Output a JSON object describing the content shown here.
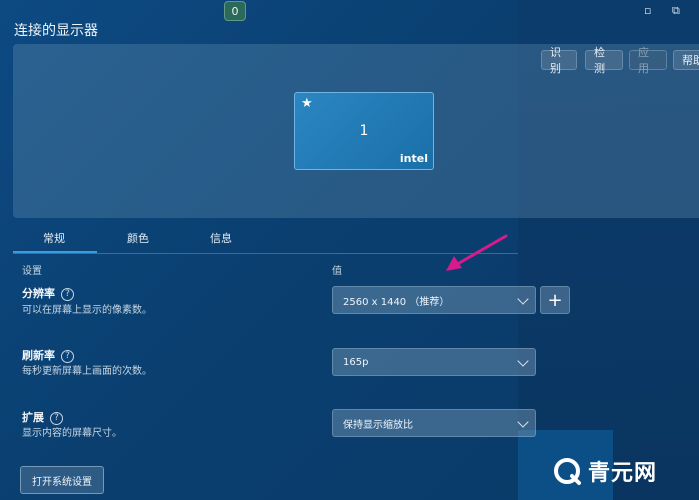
{
  "badge_count": "0",
  "window": {
    "restore_icon": "⧉",
    "minimize_icon": "▫"
  },
  "title": "连接的显示器",
  "toolbar": {
    "identify_label": "识别",
    "detect_label": "检测",
    "apply_label": "应用",
    "help_label": "帮助"
  },
  "monitor": {
    "star": "★",
    "number": "1",
    "brand": "intel"
  },
  "tabs": [
    {
      "label": "常规",
      "active": true
    },
    {
      "label": "颜色",
      "active": false
    },
    {
      "label": "信息",
      "active": false
    }
  ],
  "columns": {
    "setting": "设置",
    "value": "值"
  },
  "settings": [
    {
      "title": "分辨率",
      "desc": "可以在屏幕上显示的像素数。",
      "value": "2560 x 1440 （推荐）"
    },
    {
      "title": "刷新率",
      "desc": "每秒更新屏幕上画面的次数。",
      "value": "165p"
    },
    {
      "title": "扩展",
      "desc": "显示内容的屏幕尺寸。",
      "value": "保持显示缩放比"
    }
  ],
  "help_symbol": "?",
  "plus_symbol": "+",
  "system_settings_label": "打开系统设置",
  "watermark": {
    "text": "青元网"
  },
  "colors": {
    "accent": "#3a9be0",
    "arrow": "#d81b8a",
    "background": "#0d4a82"
  }
}
